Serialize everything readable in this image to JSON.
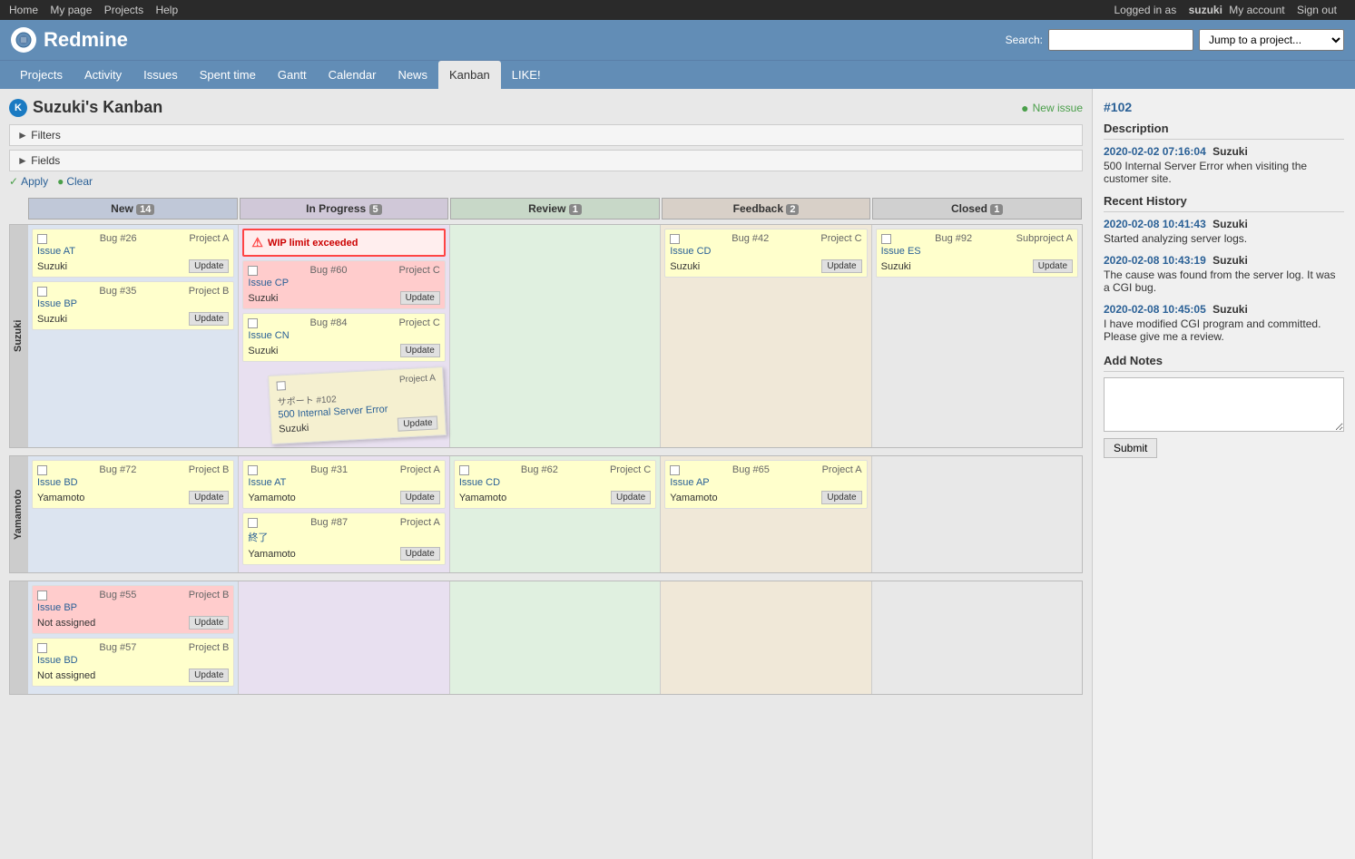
{
  "topnav": {
    "home": "Home",
    "mypage": "My page",
    "projects": "Projects",
    "help": "Help",
    "logged_in_as": "Logged in as",
    "username": "suzuki",
    "my_account": "My account",
    "sign_out": "Sign out"
  },
  "header": {
    "logo": "Redmine",
    "search_label": "Search:",
    "search_placeholder": "",
    "jump_placeholder": "Jump to a project..."
  },
  "mainnav": {
    "items": [
      {
        "label": "Projects",
        "active": false
      },
      {
        "label": "Activity",
        "active": false
      },
      {
        "label": "Issues",
        "active": false
      },
      {
        "label": "Spent time",
        "active": false
      },
      {
        "label": "Gantt",
        "active": false
      },
      {
        "label": "Calendar",
        "active": false
      },
      {
        "label": "News",
        "active": false
      },
      {
        "label": "Kanban",
        "active": true
      },
      {
        "label": "LIKE!",
        "active": false
      }
    ]
  },
  "page": {
    "title": "Suzuki's Kanban",
    "new_issue_label": "New issue",
    "filters_label": "Filters",
    "fields_label": "Fields",
    "apply_label": "Apply",
    "clear_label": "Clear"
  },
  "columns": {
    "new": {
      "label": "New",
      "count": "14"
    },
    "in_progress": {
      "label": "In Progress",
      "count": "5"
    },
    "review": {
      "label": "Review",
      "count": "1"
    },
    "feedback": {
      "label": "Feedback",
      "count": "2"
    },
    "closed": {
      "label": "Closed",
      "count": "1"
    }
  },
  "swimlanes": {
    "suzuki": {
      "label": "Suzuki",
      "new_cards": [
        {
          "id": "Bug #26",
          "project": "Project A",
          "title": "Issue AT",
          "assignee": "Suzuki",
          "bg": "yellow"
        },
        {
          "id": "Bug #35",
          "project": "Project B",
          "title": "Issue BP",
          "assignee": "Suzuki",
          "bg": "yellow"
        }
      ],
      "inprogress_cards": [
        {
          "wip": true,
          "wip_text": "WIP limit exceeded"
        },
        {
          "id": "Bug #60",
          "project": "Project C",
          "title": "Issue CP",
          "assignee": "Suzuki",
          "bg": "pink"
        },
        {
          "id": "Bug #84",
          "project": "Project C",
          "title": "Issue CN",
          "assignee": "Suzuki",
          "bg": "yellow"
        },
        {
          "sticky": true,
          "id": "サポート #102",
          "project": "Project A",
          "title": "500 Internal Server Error",
          "assignee": "Suzuki",
          "bg": "sticky"
        }
      ],
      "review_cards": [],
      "feedback_cards": [
        {
          "id": "Bug #42",
          "project": "Project C",
          "title": "Issue CD",
          "assignee": "Suzuki",
          "bg": "yellow"
        }
      ],
      "closed_cards": [
        {
          "id": "Bug #92",
          "project": "Subproject A",
          "title": "Issue ES",
          "assignee": "Suzuki",
          "bg": "yellow"
        }
      ]
    },
    "yamamoto": {
      "label": "Yamamoto",
      "new_cards": [
        {
          "id": "Bug #72",
          "project": "Project B",
          "title": "Issue BD",
          "assignee": "Yamamoto",
          "bg": "yellow"
        }
      ],
      "inprogress_cards": [
        {
          "id": "Bug #31",
          "project": "Project A",
          "title": "Issue AT",
          "assignee": "Yamamoto",
          "bg": "yellow"
        },
        {
          "id": "Bug #87",
          "project": "Project A",
          "title": "終了",
          "assignee": "Yamamoto",
          "bg": "yellow"
        }
      ],
      "review_cards": [
        {
          "id": "Bug #62",
          "project": "Project C",
          "title": "Issue CD",
          "assignee": "Yamamoto",
          "bg": "yellow"
        }
      ],
      "feedback_cards": [
        {
          "id": "Bug #65",
          "project": "Project A",
          "title": "Issue AP",
          "assignee": "Yamamoto",
          "bg": "yellow"
        }
      ],
      "closed_cards": []
    },
    "unassigned": {
      "label": "",
      "new_cards": [
        {
          "id": "Bug #55",
          "project": "Project B",
          "title": "Issue BP",
          "assignee": "Not assigned",
          "bg": "pink"
        },
        {
          "id": "Bug #57",
          "project": "Project B",
          "title": "Issue BD",
          "assignee": "Not assigned",
          "bg": "yellow"
        }
      ],
      "inprogress_cards": [],
      "review_cards": [],
      "feedback_cards": [],
      "closed_cards": []
    }
  },
  "sidebar": {
    "issue_id": "#102",
    "description_title": "Description",
    "history_entry1": {
      "timestamp": "2020-02-02 07:16:04",
      "user": "Suzuki",
      "text": "500 Internal Server Error when visiting the customer site."
    },
    "recent_history_title": "Recent History",
    "history_entry2": {
      "timestamp": "2020-02-08 10:41:43",
      "user": "Suzuki",
      "text": "Started analyzing server logs."
    },
    "history_entry3": {
      "timestamp": "2020-02-08 10:43:19",
      "user": "Suzuki",
      "text": "The cause was found from the server log. It was a CGI bug."
    },
    "history_entry4": {
      "timestamp": "2020-02-08 10:45:05",
      "user": "Suzuki",
      "text": "I have modified CGI program and committed. Please give me a review."
    },
    "add_notes_title": "Add Notes",
    "submit_label": "Submit"
  }
}
